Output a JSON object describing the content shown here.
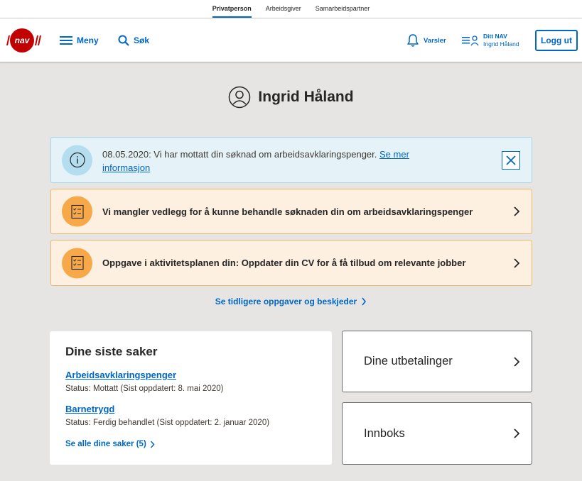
{
  "audience_tabs": [
    {
      "label": "Privatperson",
      "active": true
    },
    {
      "label": "Arbeidsgiver",
      "active": false
    },
    {
      "label": "Samarbeidspartner",
      "active": false
    }
  ],
  "header": {
    "logo_text": "nav",
    "menu_label": "Meny",
    "search_label": "Søk",
    "notifications_label": "Varsler",
    "dittnav_label": "Ditt NAV",
    "user_name": "Ingrid Håland",
    "logout_label": "Logg ut"
  },
  "profile": {
    "name": "Ingrid Håland"
  },
  "info_alert": {
    "text": "08.05.2020: Vi har mottatt din søknad om arbeidsavklaringspenger.",
    "link": "Se mer informasjon"
  },
  "tasks": [
    {
      "text": "Vi mangler vedlegg for å kunne behandle søknaden din om arbeidsavklaringspenger"
    },
    {
      "text": "Oppgave i aktivitetsplanen din:  Oppdater din CV for å få tilbud om relevante jobber"
    }
  ],
  "earlier_link": "Se tidligere oppgaver og beskjeder",
  "recent_cases": {
    "title": "Dine siste saker",
    "items": [
      {
        "title": "Arbeidsavklaringspenger",
        "status": "Status: Mottatt (Sist oppdatert: 8. mai 2020)"
      },
      {
        "title": "Barnetrygd",
        "status": "Status: Ferdig behandlet (Sist oppdatert: 2. januar 2020)"
      }
    ],
    "all_link": "Se alle dine saker (5)"
  },
  "panels": {
    "payments": "Dine utbetalinger",
    "inbox": "Innboks"
  },
  "colors": {
    "accent": "#0067c5",
    "brand_red": "#c30000",
    "info_bg": "#e5f3f8",
    "task_bg": "#fdf0e1",
    "task_icon": "#f7a94a",
    "page_bg": "#e6e5e3"
  }
}
